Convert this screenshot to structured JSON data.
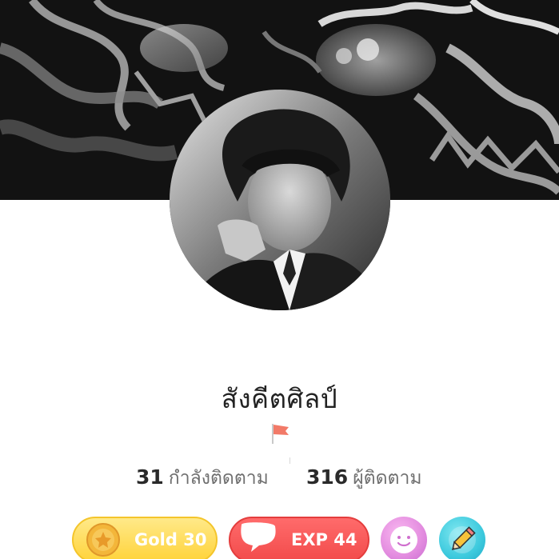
{
  "profile": {
    "name": "สังคีตศิลป์",
    "flag_icon": "red-flag-icon"
  },
  "stats": {
    "following_count": "31",
    "following_label": "กำลังติดตาม",
    "followers_count": "316",
    "followers_label": "ผู้ติดตาม"
  },
  "badges": {
    "gold_label": "Gold 30",
    "gold_color": "#ffd33a",
    "exp_label": "EXP 44",
    "exp_color": "#f24b4b"
  },
  "actions": {
    "sticker_icon": "smiley-face-icon",
    "edit_icon": "pencil-icon"
  }
}
